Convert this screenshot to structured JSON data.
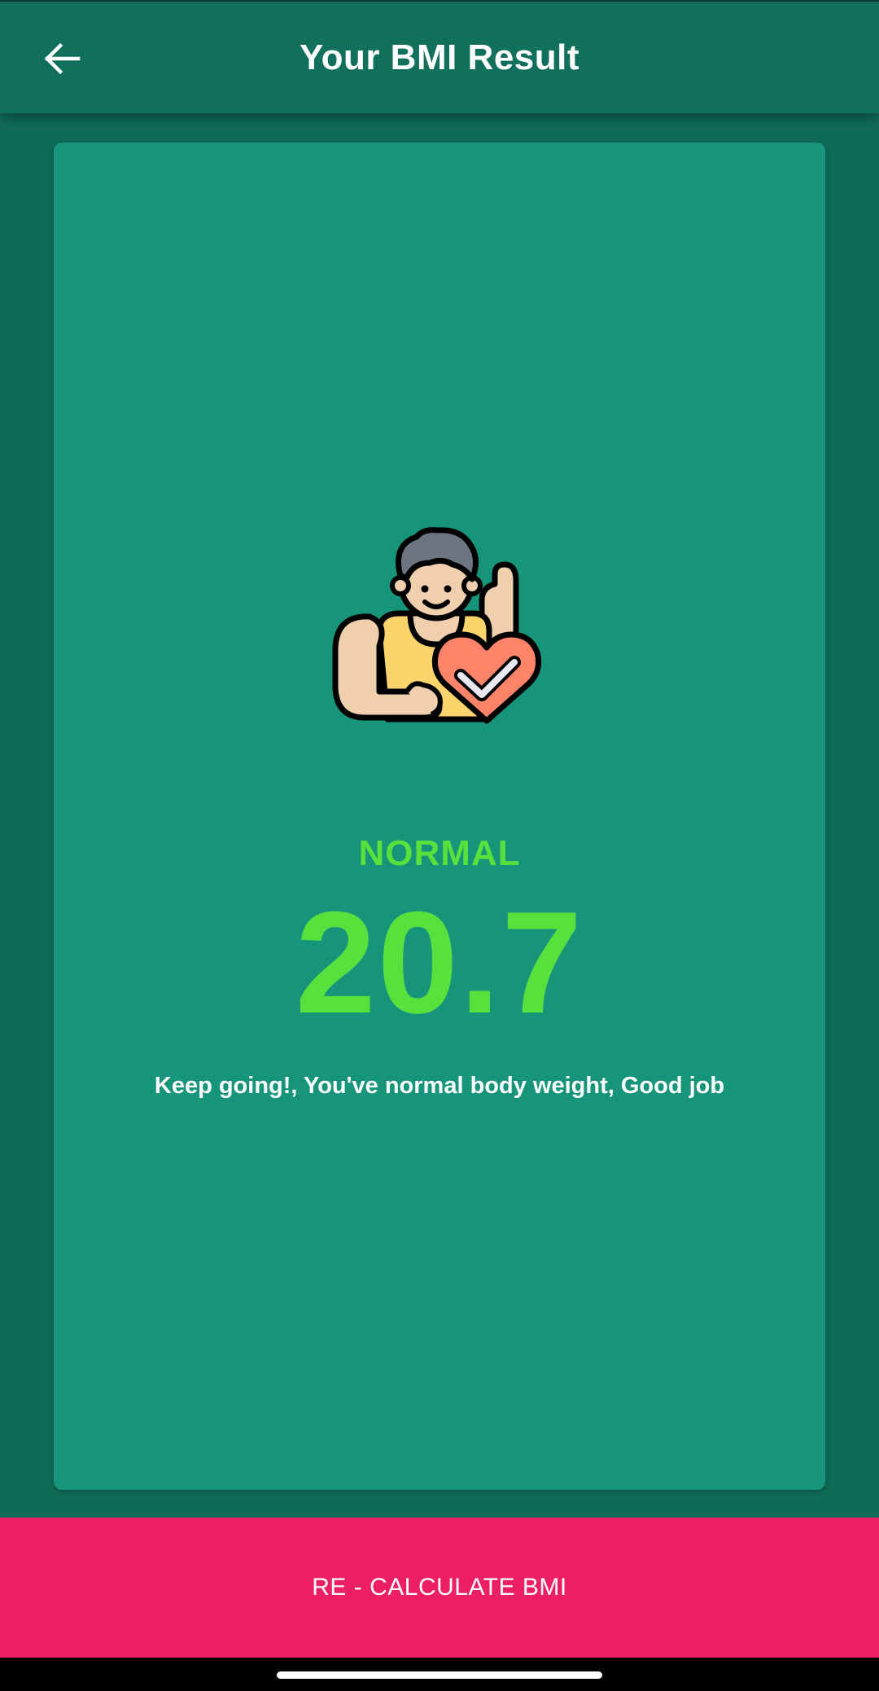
{
  "app_bar": {
    "back_icon": "arrow-left-icon",
    "title": "Your BMI Result"
  },
  "result": {
    "illustration_icon": "fit-person-heart-check-icon",
    "status": "NORMAL",
    "bmi": "20.7",
    "message": "Keep going!, You've normal body weight, Good job",
    "status_color": "#58e03c"
  },
  "actions": {
    "recalculate_label": "RE - CALCULATE BMI",
    "button_color": "#ec1f64"
  },
  "colors": {
    "background": "#0f6b58",
    "app_bar": "#10705c",
    "card": "#16957a"
  }
}
